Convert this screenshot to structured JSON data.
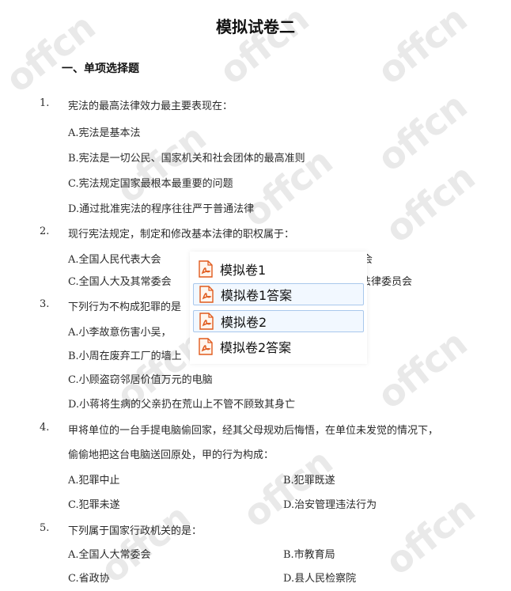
{
  "document": {
    "title": "模拟试卷二",
    "section": "一、单项选择题"
  },
  "questions": [
    {
      "num": "1.",
      "text": "宪法的最高法律效力最主要表现在：",
      "options": [
        "A.宪法是基本法",
        "B.宪法是一切公民、国家机关和社会团体的最高准则",
        "C.宪法规定国家最根本最重要的问题",
        "D.通过批准宪法的程序往往严于普通法律"
      ]
    },
    {
      "num": "2.",
      "text": "现行宪法规定，制定和修改基本法律的职权属于：",
      "options": [
        "A.全国人民代表大会",
        "C.全国人大及其常委会"
      ],
      "options_right_partial": [
        "会",
        "法律委员会"
      ]
    },
    {
      "num": "3.",
      "text": "下列行为不构成犯罪的是",
      "options": [
        "A.小李故意伤害小吴，",
        "B.小周在废弃工厂的墙上",
        "C.小顾盗窃邻居价值万元的电脑",
        "D.小蒋将生病的父亲扔在荒山上不管不顾致其身亡"
      ]
    },
    {
      "num": "4.",
      "text": "甲将单位的一台手提电脑偷回家，经其父母规劝后悔悟，在单位未发觉的情况下，",
      "text2": "偷偷地把这台电脑送回原处，甲的行为构成：",
      "options": [
        "A.犯罪中止",
        "B.犯罪既遂",
        "C.犯罪未遂",
        "D.治安管理违法行为"
      ]
    },
    {
      "num": "5.",
      "text": "下列属于国家行政机关的是：",
      "options": [
        "A.全国人大常委会",
        "B.市教育局",
        "C.省政协",
        "D.县人民检察院"
      ]
    }
  ],
  "popup": {
    "items": [
      {
        "label": "模拟卷1",
        "icon": "pdf-icon"
      },
      {
        "label": "模拟卷1答案",
        "icon": "pdf-icon"
      },
      {
        "label": "模拟卷2",
        "icon": "pdf-icon"
      },
      {
        "label": "模拟卷2答案",
        "icon": "pdf-icon"
      }
    ],
    "accent_color": "#e05a1c"
  },
  "watermark": "offcn"
}
